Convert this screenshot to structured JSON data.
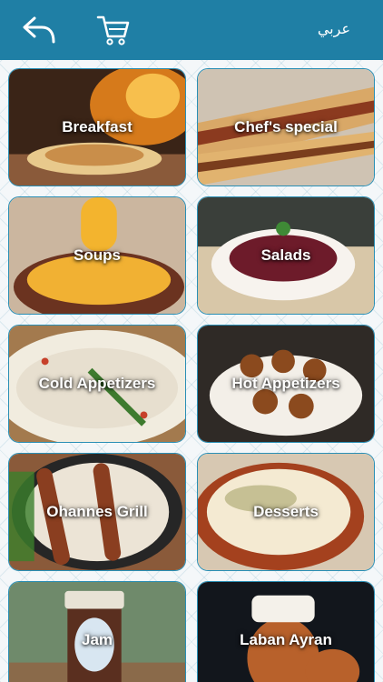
{
  "header": {
    "language_label": "عربي",
    "back_icon": "back-arrow-icon",
    "cart_icon": "cart-icon",
    "bar_color": "#1f7fa5"
  },
  "categories": [
    {
      "label": "Breakfast"
    },
    {
      "label": "Chef's special"
    },
    {
      "label": "Soups"
    },
    {
      "label": "Salads"
    },
    {
      "label": "Cold Appetizers"
    },
    {
      "label": "Hot Appetizers"
    },
    {
      "label": "Ohannes Grill"
    },
    {
      "label": "Desserts"
    },
    {
      "label": "Jam"
    },
    {
      "label": "Laban Ayran"
    }
  ]
}
